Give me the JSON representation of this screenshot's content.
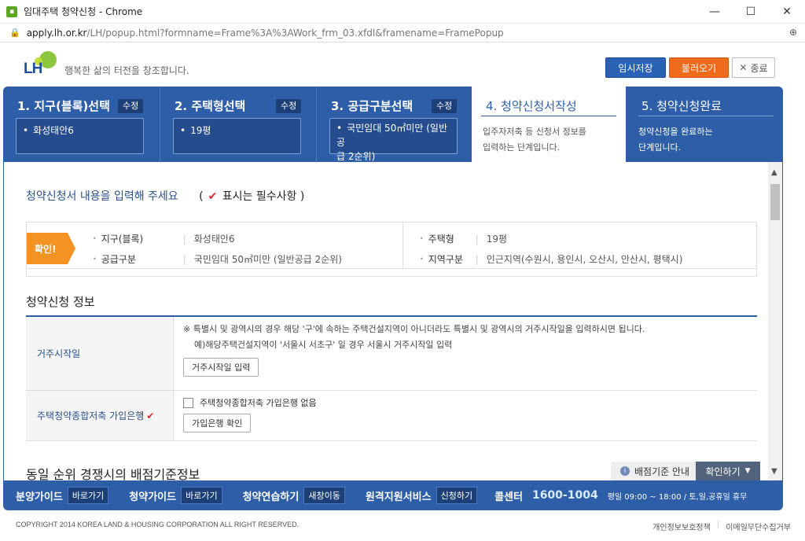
{
  "window": {
    "title": "임대주택 청약신청 - Chrome",
    "url_host": "apply.lh.or.kr",
    "url_path": "/LH/popup.html?formname=Frame%3A%3AWork_frm_03.xfdl&framename=FramePopup",
    "minimize": "—",
    "maximize": "☐",
    "close": "✕"
  },
  "header": {
    "logo_text": "LH",
    "slogan": "행복한 삶의 터전을 창조합니다.",
    "save_label": "임시저장",
    "load_label": "불러오기",
    "close_label": "종료"
  },
  "steps": [
    {
      "title": "1. 지구(블록)선택",
      "edit": "수정",
      "value": "화성태안6"
    },
    {
      "title": "2. 주택형선택",
      "edit": "수정",
      "value": "19평"
    },
    {
      "title": "3. 공급구분선택",
      "edit": "수정",
      "value_line1": "국민임대 50㎡미만 (일반공",
      "value_line2": "급 2순위)"
    },
    {
      "title": "4. 청약신청서작성",
      "desc_line1": "입주자저축 등 신청서 정보를",
      "desc_line2": "입력하는 단계입니다."
    },
    {
      "title": "5. 청약신청완료",
      "desc_line1": "청약신청을 완료하는",
      "desc_line2": "단계입니다."
    }
  ],
  "notice": {
    "text": "청약신청서 내용을 입력해 주세요",
    "paren_open": "(",
    "req": "표시는 필수사항 )"
  },
  "confirm": {
    "badge": "확인!",
    "rows": [
      {
        "label": "지구(블록)",
        "value": "화성태안6"
      },
      {
        "label": "공급구분",
        "value": "국민임대 50㎡미만 (일반공급 2순위)"
      },
      {
        "label": "주택형",
        "value": "19평"
      },
      {
        "label": "지역구분",
        "value": "인근지역(수원시, 용인시, 오산시, 안산시, 평택시)"
      }
    ]
  },
  "section1": {
    "title": "청약신청 정보",
    "rows": [
      {
        "label": "거주시작일",
        "note1": "※ 특별시 및 광역시의 경우 해당 '구'에 속하는 주택건설지역이 아니더라도 특별시 및 광역시의 거주시작일을 입력하시면 됩니다.",
        "note2": "예)해당주택건설지역이 '서울시 서초구' 일 경우 서울시 거주시작일 입력",
        "button": "거주시작일 입력"
      },
      {
        "label": "주택청약종합저축 가입은행",
        "checkbox_label": "주택청약종합저축 가입은행 없음",
        "button": "가입은행 확인"
      }
    ]
  },
  "section2": {
    "title": "동일 순위 경쟁시의 배점기준정보",
    "guide": "배점기준 안내",
    "confirm": "확인하기"
  },
  "bottombar": {
    "items": [
      {
        "label": "분양가이드",
        "tag": "바로가기"
      },
      {
        "label": "청약가이드",
        "tag": "바로가기"
      },
      {
        "label": "청약연습하기",
        "tag": "새창이동"
      },
      {
        "label": "원격지원서비스",
        "tag": "신청하기"
      }
    ],
    "call_label": "콜센터",
    "call_number": "1600-1004",
    "hours": "평일 09:00 ~ 18:00 / 토,일,공휴일 휴무"
  },
  "footer": {
    "copyright": "COPYRIGHT 2014 KOREA LAND & HOUSING CORPORATION ALL RIGHT RESERVED.",
    "link1": "개인정보보호정책",
    "link2": "이메일무단수집거부"
  }
}
